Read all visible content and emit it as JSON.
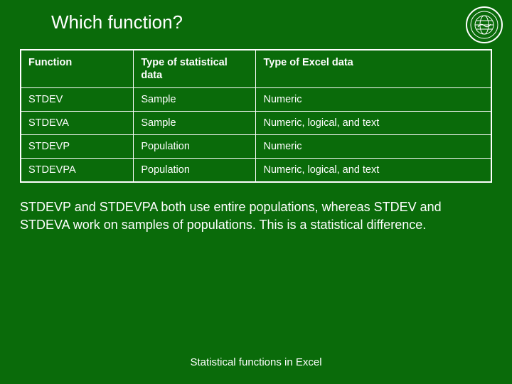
{
  "title": "Which function?",
  "table": {
    "headers": [
      "Function",
      "Type of statistical data",
      "Type of Excel data"
    ],
    "rows": [
      [
        "STDEV",
        "Sample",
        "Numeric"
      ],
      [
        "STDEVA",
        "Sample",
        "Numeric, logical, and text"
      ],
      [
        "STDEVP",
        "Population",
        "Numeric"
      ],
      [
        "STDEVPA",
        "Population",
        "Numeric, logical, and text"
      ]
    ]
  },
  "body_text": "STDEVP and STDEVPA both use entire populations, whereas STDEV and STDEVA work on samples of populations. This is a statistical difference.",
  "footer": "Statistical functions in Excel"
}
